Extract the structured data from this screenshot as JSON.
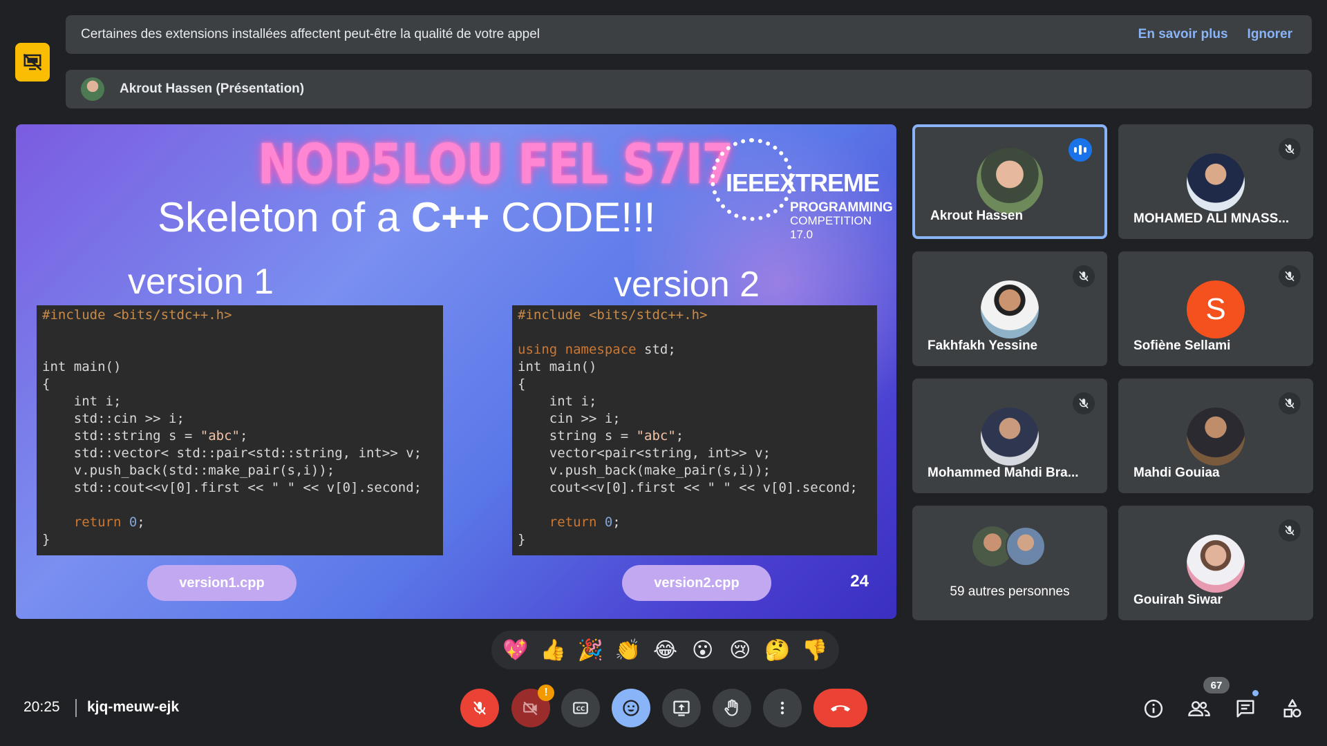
{
  "notice": {
    "text": "Certaines des extensions installées affectent peut-être la qualité de votre appel",
    "learn_more": "En savoir plus",
    "ignore": "Ignorer"
  },
  "presenting": {
    "label": "Akrout Hassen (Présentation)"
  },
  "slide": {
    "title": "NOD5LOU FEL S7I7",
    "subtitle_prefix": "Skeleton of a ",
    "subtitle_bold": "C++",
    "subtitle_suffix": " CODE!!!",
    "logo_ieee": "IEEEXTREME",
    "logo_programming": "PROGRAMMING",
    "logo_competition": "COMPETITION 17.0",
    "version1_label": "version 1",
    "version2_label": "version 2",
    "version1_file": "version1.cpp",
    "version2_file": "version2.cpp",
    "page_number": "24",
    "code_v1": {
      "line1": "#include <bits/stdc++.h>",
      "line2": "int main()",
      "line3": "{",
      "line4": "    int i;",
      "line5": "    std::cin >> i;",
      "line6_a": "    std::string s = ",
      "line6_b": "\"abc\"",
      "line6_c": ";",
      "line7": "    std::vector< std::pair<std::string, int>> v;",
      "line8": "    v.push_back(std::make_pair(s,i));",
      "line9": "    std::cout<<v[0].first << \" \" << v[0].second;",
      "line10_a": "    return ",
      "line10_b": "0",
      "line10_c": ";",
      "line11": "}"
    },
    "code_v2": {
      "line1": "#include <bits/stdc++.h>",
      "line2_a": "using namespace",
      "line2_b": " std;",
      "line3": "int main()",
      "line4": "{",
      "line5": "    int i;",
      "line6": "    cin >> i;",
      "line7_a": "    string s = ",
      "line7_b": "\"abc\"",
      "line7_c": ";",
      "line8": "    vector<pair<string, int>> v;",
      "line9": "    v.push_back(make_pair(s,i));",
      "line10": "    cout<<v[0].first << \" \" << v[0].second;",
      "line11_a": "    return ",
      "line11_b": "0",
      "line11_c": ";",
      "line12": "}"
    }
  },
  "participants": [
    {
      "name": "Akrout Hassen"
    },
    {
      "name": "MOHAMED ALI MNASS..."
    },
    {
      "name": "Fakhfakh Yessine"
    },
    {
      "name": "Sofiène Sellami",
      "initial": "S"
    },
    {
      "name": "Mohammed Mahdi Bra..."
    },
    {
      "name": "Mahdi Gouiaa"
    },
    {
      "name": "59 autres personnes"
    },
    {
      "name": "Gouirah Siwar"
    }
  ],
  "reactions": [
    "💖",
    "👍",
    "🎉",
    "👏",
    "😂",
    "😮",
    "😢",
    "🤔",
    "👎"
  ],
  "bottom": {
    "time": "20:25",
    "meeting_code": "kjq-meuw-ejk",
    "participant_count": "67",
    "camera_warning": "!"
  },
  "icons": {
    "badge": "presentation-off-icon",
    "mic": "mic-off-icon",
    "camera": "camera-off-icon",
    "captions": "captions-icon",
    "emoji": "emoji-icon",
    "present": "present-screen-icon",
    "hand": "raise-hand-icon",
    "more": "more-vertical-icon",
    "hangup": "hang-up-icon",
    "info": "info-icon",
    "people": "people-icon",
    "chat": "chat-icon",
    "activities": "activities-icon"
  },
  "colors": {
    "background": "#202124",
    "surface": "#3c4043",
    "accent_blue": "#8ab4f8",
    "danger_red": "#ea4335",
    "warning_yellow": "#fbbc04"
  }
}
